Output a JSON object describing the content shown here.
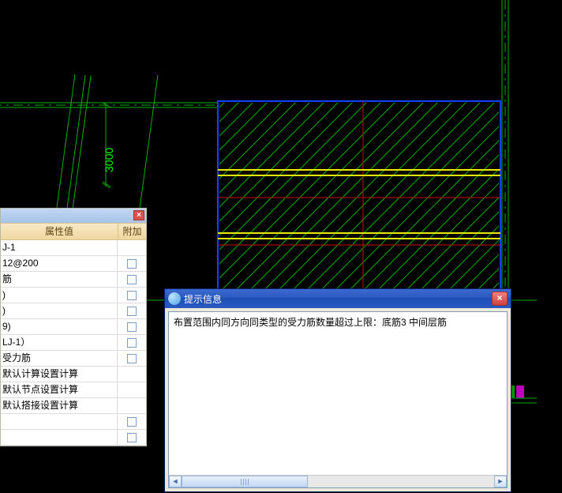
{
  "dimension": {
    "d3000": "3000"
  },
  "prop_panel": {
    "header": {
      "val": "属性值",
      "add": "附加"
    },
    "rows": [
      {
        "val": "J-1",
        "chk": false
      },
      {
        "val": "12@200",
        "chk": true
      },
      {
        "val": "筋",
        "chk": true
      },
      {
        "val": ")",
        "chk": true
      },
      {
        "val": ")",
        "chk": true
      },
      {
        "val": "9)",
        "chk": true
      },
      {
        "val": "LJ-1）",
        "chk": true
      },
      {
        "val": "受力筋",
        "chk": true
      },
      {
        "val": "默认计算设置计算",
        "chk": false
      },
      {
        "val": "默认节点设置计算",
        "chk": false
      },
      {
        "val": "默认搭接设置计算",
        "chk": false
      },
      {
        "val": "",
        "chk": true
      },
      {
        "val": "",
        "chk": true
      }
    ]
  },
  "dialog": {
    "title": "提示信息",
    "message": "布置范围内同方向同类型的受力筋数量超过上限：底筋3 中间层筋"
  }
}
